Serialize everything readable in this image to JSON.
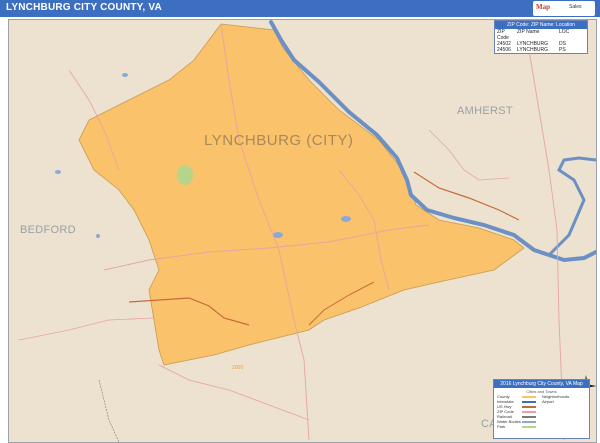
{
  "header": {
    "title": "LYNCHBURG CITY COUNTY, VA",
    "logo_text": "Map",
    "logo_sub": "Sales"
  },
  "map": {
    "county_name": "LYNCHBURG (CITY)",
    "neighbors": {
      "west": "BEDFORD",
      "northeast": "AMHERST",
      "southeast": "CA"
    },
    "colors": {
      "county_fill": "#f9c26b",
      "background": "#ece2cf",
      "river": "#6c8fc4",
      "roads": "#e8a3a3",
      "highway": "#c86a3a",
      "water_bodies": "#8aa8d8",
      "park": "#b6d48a"
    },
    "scale_label": "2000"
  },
  "zip_table": {
    "title": "ZIP Code: ZIP Name: Location",
    "headers": [
      "ZIP Code",
      "ZIP Name",
      "LOC"
    ],
    "rows": [
      [
        "24502",
        "LYNCHBURG",
        "DS"
      ],
      [
        "24506",
        "LYNCHBURG",
        "PS"
      ]
    ]
  },
  "legend": {
    "title": "2016 Lynchburg City County, VA Map",
    "subtitle": "Cities and Towns",
    "items": [
      "County",
      "Interstate",
      "US Hwy",
      "ZIP Code",
      "Railroad",
      "Water Bodies",
      "Park",
      "Neighborhoods",
      "Airport"
    ]
  },
  "compass": {
    "label": "N"
  }
}
